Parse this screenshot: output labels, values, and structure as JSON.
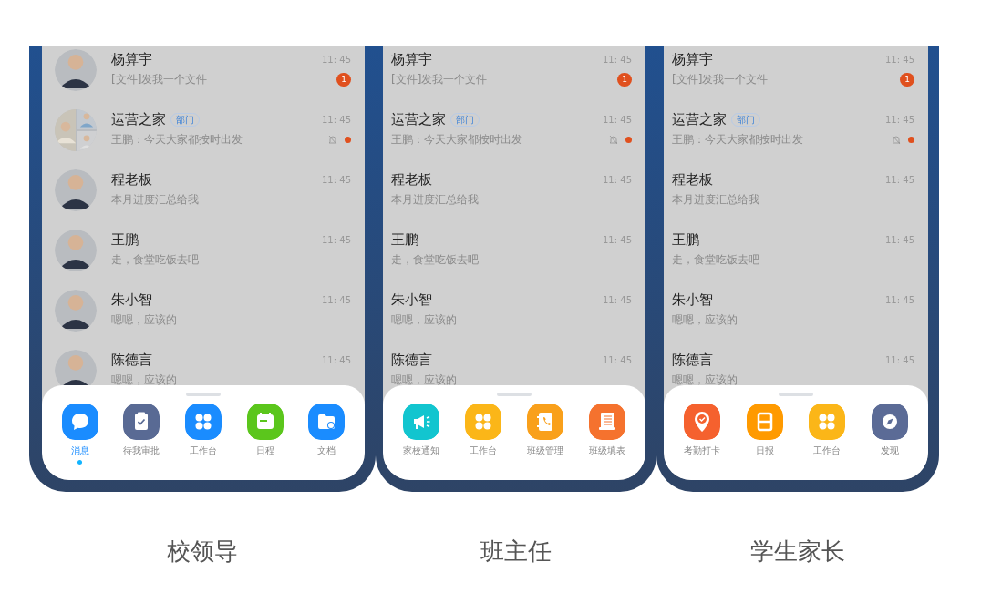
{
  "phones": [
    {
      "caption": "校领导",
      "chats": [
        {
          "name": "杨算宇",
          "preview": "[文件]发我一个文件",
          "time": "11: 45",
          "badge": "1",
          "muted": false,
          "avatar": {
            "kind": "single"
          }
        },
        {
          "name": "运营之家",
          "tag": "部门",
          "preview": "王鹏：今天大家都按时出发",
          "time": "11: 45",
          "muted": true,
          "avatar": {
            "kind": "group"
          }
        },
        {
          "name": "程老板",
          "preview": "本月进度汇总给我",
          "time": "11: 45",
          "muted": false,
          "avatar": {
            "kind": "single"
          }
        },
        {
          "name": "王鹏",
          "preview": "走，食堂吃饭去吧",
          "time": "11: 45",
          "muted": false,
          "avatar": {
            "kind": "single"
          }
        },
        {
          "name": "朱小智",
          "preview": "嗯嗯，应该的",
          "time": "11: 45",
          "muted": false,
          "avatar": {
            "kind": "single"
          }
        },
        {
          "name": "陈德言",
          "preview": "嗯嗯，应该的",
          "time": "11: 45",
          "muted": false,
          "avatar": {
            "kind": "single"
          }
        }
      ],
      "dock": [
        {
          "label": "消息",
          "kind": "chat",
          "color": "#1a8cff",
          "selected": true
        },
        {
          "label": "待我审批",
          "kind": "clipboard",
          "color": "#596a94",
          "selected": false
        },
        {
          "label": "工作台",
          "kind": "grid",
          "color": "#1a8cff",
          "selected": false
        },
        {
          "label": "日程",
          "kind": "calendar",
          "color": "#5bc61c",
          "selected": false
        },
        {
          "label": "文档",
          "kind": "folder",
          "color": "#1a8cff",
          "selected": false
        }
      ]
    },
    {
      "caption": "班主任",
      "chats": [
        {
          "name": "杨算宇",
          "preview": "[文件]发我一个文件",
          "time": "11: 45",
          "badge": "1",
          "muted": false
        },
        {
          "name": "运营之家",
          "tag": "部门",
          "preview": "王鹏：今天大家都按时出发",
          "time": "11: 45",
          "muted": true
        },
        {
          "name": "程老板",
          "preview": "本月进度汇总给我",
          "time": "11: 45",
          "muted": false
        },
        {
          "name": "王鹏",
          "preview": "走，食堂吃饭去吧",
          "time": "11: 45",
          "muted": false
        },
        {
          "name": "朱小智",
          "preview": "嗯嗯，应该的",
          "time": "11: 45",
          "muted": false
        },
        {
          "name": "陈德言",
          "preview": "嗯嗯，应该的",
          "time": "11: 45",
          "muted": false
        }
      ],
      "dock": [
        {
          "label": "家校通知",
          "kind": "megaphone",
          "color": "#12c5cf",
          "selected": false
        },
        {
          "label": "工作台",
          "kind": "grid",
          "color": "#fbb618",
          "selected": false
        },
        {
          "label": "班级管理",
          "kind": "phonebook",
          "color": "#f9a01b",
          "selected": false
        },
        {
          "label": "班级填表",
          "kind": "form",
          "color": "#f5722e",
          "selected": false
        }
      ]
    },
    {
      "caption": "学生家长",
      "chats": [
        {
          "name": "杨算宇",
          "preview": "[文件]发我一个文件",
          "time": "11: 45",
          "badge": "1",
          "muted": false
        },
        {
          "name": "运营之家",
          "tag": "部门",
          "preview": "王鹏：今天大家都按时出发",
          "time": "11: 45",
          "muted": true
        },
        {
          "name": "程老板",
          "preview": "本月进度汇总给我",
          "time": "11: 45",
          "muted": false
        },
        {
          "name": "王鹏",
          "preview": "走，食堂吃饭去吧",
          "time": "11: 45",
          "muted": false
        },
        {
          "name": "朱小智",
          "preview": "嗯嗯，应该的",
          "time": "11: 45",
          "muted": false
        },
        {
          "name": "陈德言",
          "preview": "嗯嗯，应该的",
          "time": "11: 45",
          "muted": false
        }
      ],
      "dock": [
        {
          "label": "考勤打卡",
          "kind": "pin",
          "color": "#f5612e",
          "selected": false
        },
        {
          "label": "日报",
          "kind": "daily",
          "color": "#ff9a00",
          "selected": false
        },
        {
          "label": "工作台",
          "kind": "grid",
          "color": "#fbb618",
          "selected": false
        },
        {
          "label": "发现",
          "kind": "compass",
          "color": "#5b6b96",
          "selected": false
        }
      ]
    }
  ]
}
